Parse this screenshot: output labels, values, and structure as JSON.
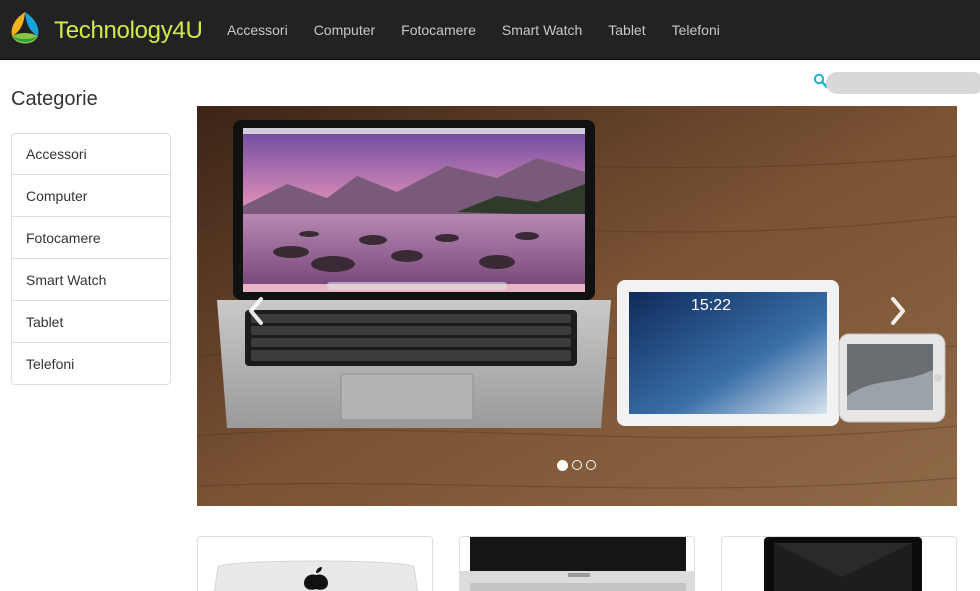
{
  "brand": {
    "name": "Technology4U"
  },
  "nav": {
    "items": [
      {
        "label": "Accessori"
      },
      {
        "label": "Computer"
      },
      {
        "label": "Fotocamere"
      },
      {
        "label": "Smart Watch"
      },
      {
        "label": "Tablet"
      },
      {
        "label": "Telefoni"
      }
    ]
  },
  "search": {
    "value": "",
    "placeholder": ""
  },
  "sidebar": {
    "title": "Categorie",
    "items": [
      {
        "label": "Accessori"
      },
      {
        "label": "Computer"
      },
      {
        "label": "Fotocamere"
      },
      {
        "label": "Smart Watch"
      },
      {
        "label": "Tablet"
      },
      {
        "label": "Telefoni"
      }
    ]
  },
  "carousel": {
    "slides_count": 3,
    "active_index": 0,
    "tablet_time": "15:22"
  },
  "colors": {
    "navbar_bg": "#222222",
    "brand_text": "#d4e84e",
    "search_icon": "#17b3d6"
  },
  "icons": {
    "logo": "technology4u-logo",
    "search": "search-icon",
    "prev": "chevron-left-icon",
    "next": "chevron-right-icon"
  }
}
